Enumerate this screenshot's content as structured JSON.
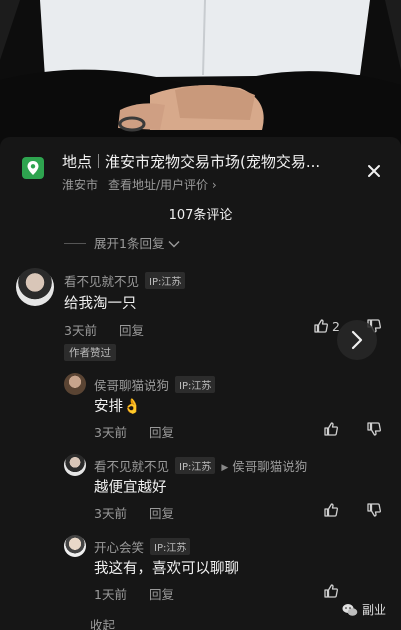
{
  "location": {
    "label": "地点",
    "title": "淮安市宠物交易市场(宠物交易...",
    "city": "淮安市",
    "sub_link": "查看地址/用户评价 ›"
  },
  "comment_count": "107条评论",
  "expand_top": "展开1条回复",
  "comments": [
    {
      "username": "看不见就不见",
      "ip": "IP:江苏",
      "content": "给我淘一只",
      "time": "3天前",
      "reply_label": "回复",
      "likes": "2",
      "author_liked": "作者赞过"
    },
    {
      "username": "侯哥聊猫说狗",
      "ip": "IP:江苏",
      "content": "安排👌",
      "time": "3天前",
      "reply_label": "回复"
    },
    {
      "username": "看不见就不见",
      "ip": "IP:江苏",
      "reply_to": "侯哥聊猫说狗",
      "content": "越便宜越好",
      "time": "3天前",
      "reply_label": "回复"
    },
    {
      "username": "开心会笑",
      "ip": "IP:江苏",
      "content": "我这有，喜欢可以聊聊",
      "time": "1天前",
      "reply_label": "回复"
    }
  ],
  "collapse_label": "收起",
  "watermark": "副业",
  "colors": {
    "sheet_bg": "#161616",
    "location_icon": "#2ea44f",
    "muted_text": "#9a9a9a"
  }
}
